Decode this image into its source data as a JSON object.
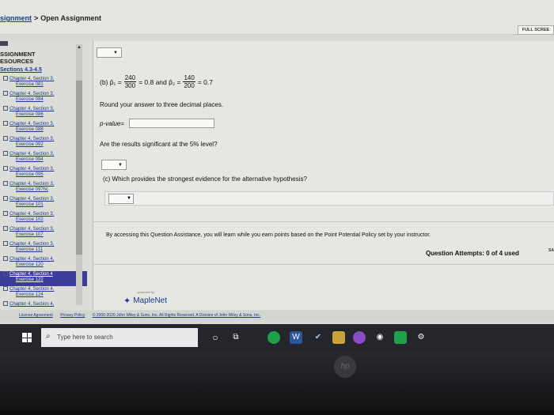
{
  "breadcrumb": {
    "link": "signment",
    "separator": ">",
    "current": "Open Assignment"
  },
  "fullscreen_label": "FULL SCREE",
  "sidebar": {
    "tab": "≡",
    "heading_line1": "SSIGNMENT",
    "heading_line2": "ESOURCES",
    "section": "Sections 4.3-4.5",
    "items": [
      {
        "title": "Chapter 4, Section 3,",
        "sub": "Exercise 081"
      },
      {
        "title": "Chapter 4, Section 3,",
        "sub": "Exercise 084"
      },
      {
        "title": "Chapter 4, Section 3,",
        "sub": "Exercise 086"
      },
      {
        "title": "Chapter 4, Section 3,",
        "sub": "Exercise 088"
      },
      {
        "title": "Chapter 4, Section 3,",
        "sub": "Exercise 092"
      },
      {
        "title": "Chapter 4, Section 3,",
        "sub": "Exercise 094"
      },
      {
        "title": "Chapter 4, Section 3,",
        "sub": "Exercise 095"
      },
      {
        "title": "Chapter 4, Section 3,",
        "sub": "Exercise 097hc"
      },
      {
        "title": "Chapter 4, Section 3,",
        "sub": "Exercise 101"
      },
      {
        "title": "Chapter 4, Section 3,",
        "sub": "Exercise 102"
      },
      {
        "title": "Chapter 4, Section 3,",
        "sub": "Exercise 107"
      },
      {
        "title": "Chapter 4, Section 3,",
        "sub": "Exercise 111"
      },
      {
        "title": "Chapter 4, Section 4,",
        "sub": "Exercise 120"
      },
      {
        "title": "Chapter 4, Section 4",
        "sub": "Exercise 122",
        "active": true
      },
      {
        "title": "Chapter 4, Section 4,",
        "sub": "Exercise 124"
      },
      {
        "title": "Chapter 4, Section 4,",
        "sub": ""
      }
    ]
  },
  "question": {
    "part_b_label": "(b)",
    "p1_symbol": "p̂₁",
    "p1_num": "240",
    "p1_den": "300",
    "p1_result": "= 0.8 and",
    "p2_symbol": "p̂₂",
    "p2_num": "140",
    "p2_den": "200",
    "p2_result": "= 0.7",
    "round_instruction": "Round your answer to three decimal places.",
    "pvalue_label": "p-value=",
    "pvalue_value": "",
    "significance_question": "Are the results significant at the 5% level?",
    "part_c_question": "(c) Which provides the strongest evidence for the alternative hypothesis?",
    "dropdown_arrow": "▼"
  },
  "assistance_notice": "By accessing this Question Assistance, you will learn while you earn points based on the Point Potential Policy set by your instructor.",
  "question_attempts": "Question Attempts: 0 of 4 used",
  "save_label": "SA",
  "maplenet": {
    "powered": "powered by",
    "brand": "MapleNet"
  },
  "footer": {
    "license": "License Agreement",
    "privacy": "Privacy Policy",
    "copyright": "© 2000-2020 John Wiley & Sons, Inc. All Rights Reserved. A Division of John Wiley & Sons, Inc."
  },
  "taskbar": {
    "search_placeholder": "Type here to search"
  },
  "bezel_logo": "hp"
}
